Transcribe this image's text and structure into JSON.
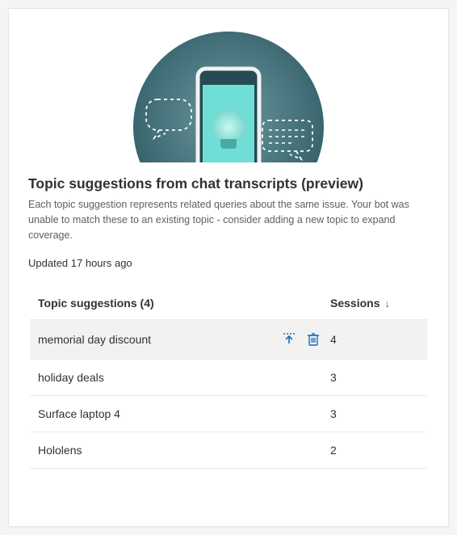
{
  "header": {
    "title": "Topic suggestions from chat transcripts (preview)",
    "description": "Each topic suggestion represents related queries about the same issue. Your bot was unable to match these to an existing topic - consider adding a new topic to expand coverage.",
    "updated": "Updated 17 hours ago"
  },
  "table": {
    "columns": {
      "name": "Topic suggestions (4)",
      "sessions": "Sessions"
    },
    "rows": [
      {
        "name": "memorial day discount",
        "sessions": "4",
        "highlight": true,
        "show_actions": true
      },
      {
        "name": "holiday deals",
        "sessions": "3",
        "highlight": false,
        "show_actions": false
      },
      {
        "name": "Surface laptop 4",
        "sessions": "3",
        "highlight": false,
        "show_actions": false
      },
      {
        "name": "Hololens",
        "sessions": "2",
        "highlight": false,
        "show_actions": false
      }
    ]
  },
  "icons": {
    "add": "add-topic-icon",
    "delete": "delete-icon"
  }
}
